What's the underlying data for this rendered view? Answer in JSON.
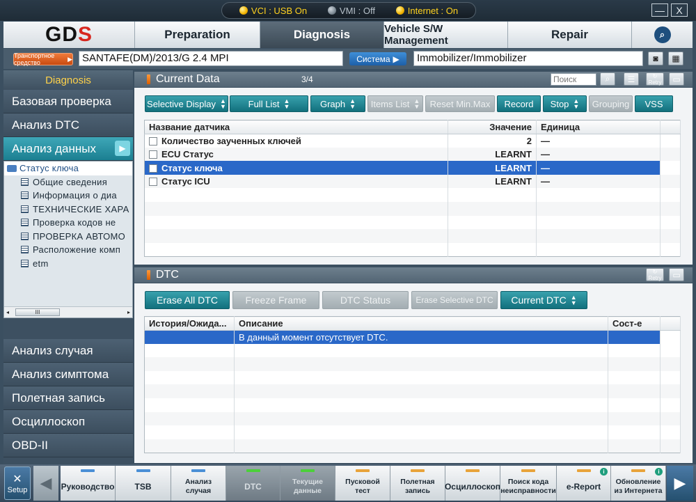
{
  "status_bar": {
    "vci": {
      "label": "VCI : USB On",
      "state": "on"
    },
    "vmi": {
      "label": "VMI : Off",
      "state": "off"
    },
    "internet": {
      "label": "Internet : On",
      "state": "on"
    }
  },
  "window_controls": {
    "minimize": "—",
    "close": "X"
  },
  "nav": {
    "logo": {
      "main": "GD",
      "accent": "S"
    },
    "tabs": [
      "Preparation",
      "Diagnosis",
      "Vehicle S/W Management",
      "Repair"
    ],
    "active_tab": "Diagnosis",
    "search_icon": "magnifier-icon"
  },
  "vehicle": {
    "badge": "Транспортное средство",
    "model": "SANTAFE(DM)/2013/G 2.4 MPI",
    "system_button": "Система",
    "system_value": "Immobilizer/Immobilizer"
  },
  "sidebar": {
    "title": "Diagnosis",
    "items": [
      "Базовая проверка",
      "Анализ DTC",
      "Анализ данных"
    ],
    "active_item": "Анализ данных",
    "tree": {
      "root": "Статус ключа",
      "children": [
        "Общие сведения",
        "Информация о диа",
        "ТЕХНИЧЕСКИЕ ХАРА",
        "Проверка кодов не",
        "ПРОВЕРКА АВТОМО",
        "Расположение комп",
        "etm"
      ]
    },
    "scroll_thumb": "III",
    "bottom_items": [
      "Анализ случая",
      "Анализ симптома",
      "Полетная запись",
      "Осциллоскоп",
      "OBD-II"
    ]
  },
  "current_data": {
    "title": "Current Data",
    "page": "3/4",
    "search_placeholder": "Поиск",
    "retry_label": "Retry",
    "buttons": [
      {
        "label": "Selective Display",
        "spinner": true,
        "enabled": true
      },
      {
        "label": "Full List",
        "spinner": true,
        "enabled": true
      },
      {
        "label": "Graph",
        "spinner": true,
        "enabled": true
      },
      {
        "label": "Items List",
        "spinner": true,
        "enabled": false
      },
      {
        "label": "Reset Min.Max",
        "spinner": false,
        "enabled": false
      },
      {
        "label": "Record",
        "spinner": false,
        "enabled": true
      },
      {
        "label": "Stop",
        "spinner": true,
        "enabled": true
      },
      {
        "label": "Grouping",
        "spinner": false,
        "enabled": false
      },
      {
        "label": "VSS",
        "spinner": false,
        "enabled": true
      }
    ],
    "columns": [
      "Название датчика",
      "Значение",
      "Единица"
    ],
    "rows": [
      {
        "name": "Количество заученных ключей",
        "value": "2",
        "unit": "—"
      },
      {
        "name": "ECU Статус",
        "value": "LEARNT",
        "unit": "—"
      },
      {
        "name": "Статус ключа",
        "value": "LEARNT",
        "unit": "—",
        "selected": true
      },
      {
        "name": "Статус ICU",
        "value": "LEARNT",
        "unit": "—"
      }
    ]
  },
  "dtc": {
    "title": "DTC",
    "retry_label": "Retry",
    "buttons": [
      {
        "label": "Erase All DTC",
        "spinner": false,
        "enabled": true
      },
      {
        "label": "Freeze Frame",
        "spinner": false,
        "enabled": false
      },
      {
        "label": "DTC Status",
        "spinner": false,
        "enabled": false
      },
      {
        "label": "Erase Selective DTC",
        "spinner": false,
        "enabled": false
      },
      {
        "label": "Current DTC",
        "spinner": true,
        "enabled": true
      }
    ],
    "columns": [
      "История/Ожида...",
      "Описание",
      "Сост-е"
    ],
    "rows": [
      {
        "history": "",
        "description": "В данный момент отсутствует DTC.",
        "state": ""
      }
    ]
  },
  "bottom_bar": {
    "setup": "Setup",
    "items": [
      {
        "label": "Руководство",
        "led": "#4a8fd6"
      },
      {
        "label": "TSB",
        "led": "#4a8fd6"
      },
      {
        "label": "Анализ случая",
        "led": "#4a8fd6"
      },
      {
        "label": "DTC",
        "led": "#4ccf3a",
        "active": true
      },
      {
        "label": "Текущие данные",
        "led": "#4ccf3a",
        "active": true
      },
      {
        "label": "Пусковой тест",
        "led": "#e8a33a"
      },
      {
        "label": "Полетная запись",
        "led": "#e8a33a"
      },
      {
        "label": "Осциллоскоп",
        "led": "#e8a33a"
      },
      {
        "label": "Поиск кода неисправности",
        "led": "#e8a33a"
      },
      {
        "label": "e-Report",
        "led": "#e8a33a",
        "info": true
      },
      {
        "label": "Обновление из Интернета",
        "led": "#e8a33a",
        "info": true
      }
    ]
  },
  "colors": {
    "accent": "#12707d",
    "selection": "#2a68c8",
    "status_on": "#ffd21f"
  }
}
